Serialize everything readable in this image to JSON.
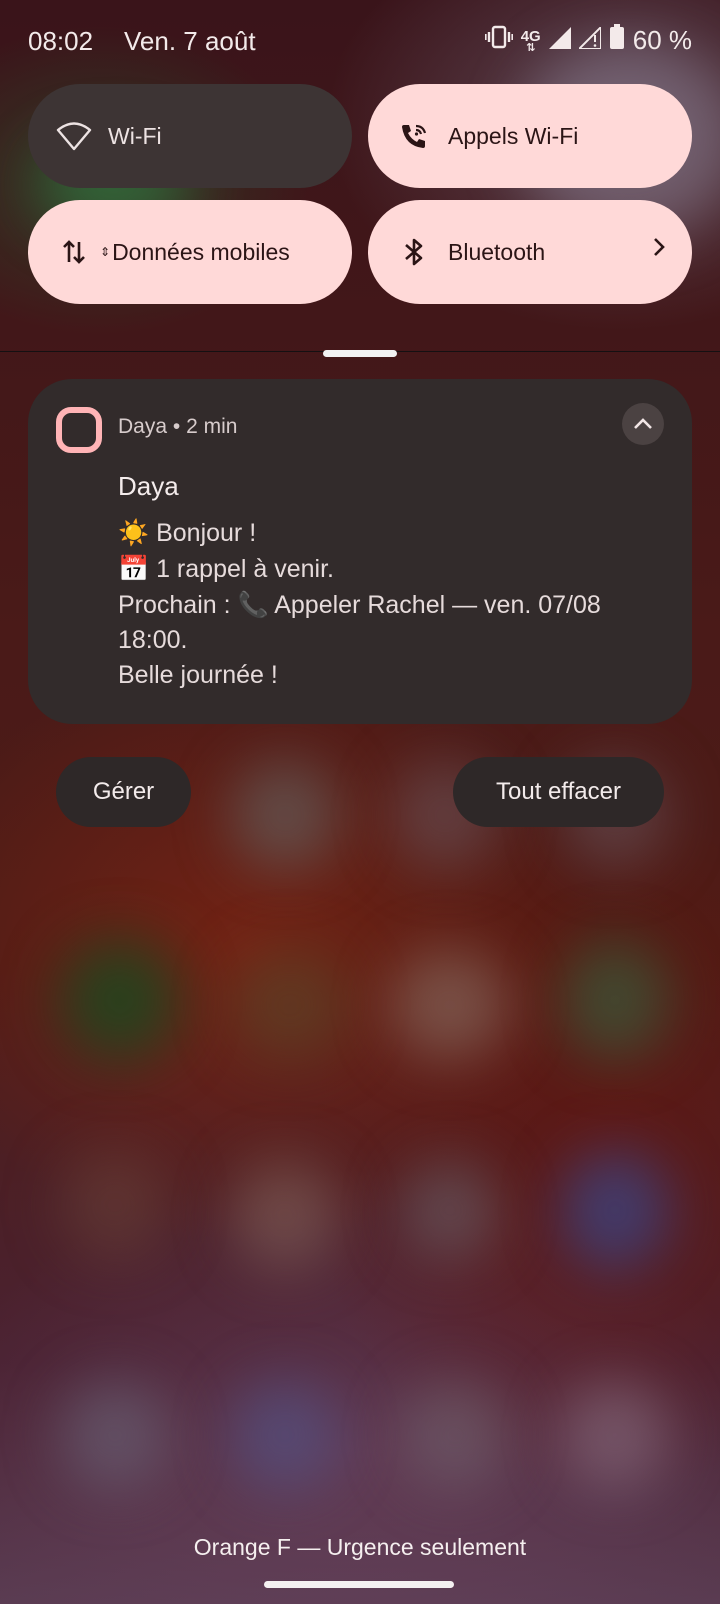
{
  "status_bar": {
    "time": "08:02",
    "date": "Ven. 7 août",
    "network": "4G",
    "battery": "60 %"
  },
  "quick_tiles": [
    {
      "label": "Wi-Fi",
      "icon": "wifi-icon",
      "active": false
    },
    {
      "label": "Appels Wi-Fi",
      "icon": "wifi-calling-icon",
      "active": true
    },
    {
      "label": "Données mobiles",
      "icon": "mobile-data-icon",
      "active": true
    },
    {
      "label": "Bluetooth",
      "icon": "bluetooth-icon",
      "active": true,
      "has_chevron": true
    }
  ],
  "notification": {
    "app": "Daya",
    "time": "2 min",
    "title": "Daya",
    "lines": [
      {
        "emoji": "☀️",
        "text": " Bonjour !"
      },
      {
        "emoji": "📅",
        "text": " 1 rappel à venir."
      },
      {
        "prefix": "Prochain : ",
        "emoji": "📞",
        "text": " Appeler Rachel — ven. 07/08"
      },
      {
        "text": "18:00."
      },
      {
        "text": "Belle journée !"
      }
    ]
  },
  "actions": {
    "manage": "Gérer",
    "clear_all": "Tout effacer"
  },
  "carrier_text": "Orange F — Urgence seulement",
  "colors": {
    "tile_active": "#ffd9d8",
    "tile_inactive": "#3d3434",
    "notification_bg": "#322b2b",
    "app_icon": "#ffb4b6"
  }
}
